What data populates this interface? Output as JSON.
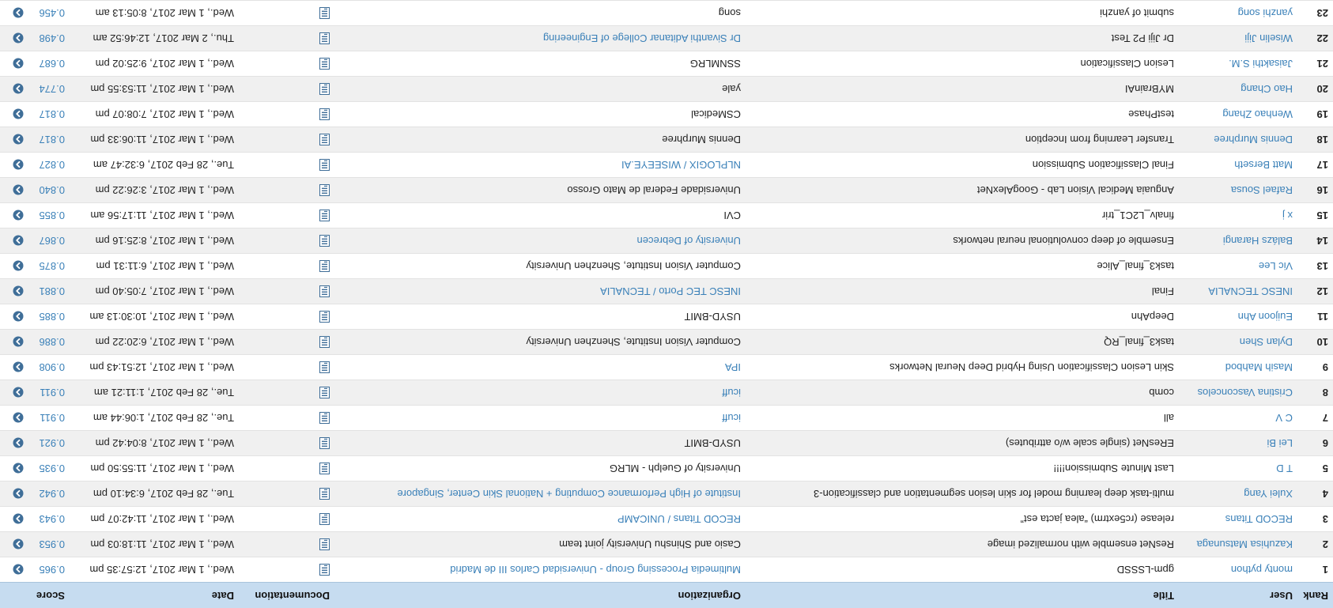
{
  "colors": {
    "header_bg": "#c6dcf0",
    "link": "#3a80b8",
    "row_alt": "#f0f0f0",
    "icon": "#3f6e98"
  },
  "columns": {
    "rank": "Rank",
    "user": "User",
    "title": "Title",
    "organization": "Organization",
    "documentation": "Documentation",
    "date": "Date",
    "score": "Score"
  },
  "rows": [
    {
      "rank": "1",
      "user": "monty python",
      "title": "gpm-LSSSD",
      "organization": "Multimedia Processing Group - Universidad Carlos III de Madrid",
      "org_link": true,
      "date": "Wed., 1 Mar 2017, 12:57:35 pm",
      "score": "0.965"
    },
    {
      "rank": "2",
      "user": "Kazuhisa Matsunaga",
      "title": "ResNet ensemble with normalized image",
      "organization": "Casio and Shinshu University joint team",
      "org_link": false,
      "date": "Wed., 1 Mar 2017, 11:18:03 pm",
      "score": "0.953"
    },
    {
      "rank": "3",
      "user": "RECOD Titans",
      "title": "release (rc5extrm) “alea jacta est”",
      "organization": "RECOD Titans / UNICAMP",
      "org_link": true,
      "date": "Wed., 1 Mar 2017, 11:42:07 pm",
      "score": "0.943"
    },
    {
      "rank": "4",
      "user": "Xulei Yang",
      "title": "multi-task deep learning model for skin lesion segmentation and classification-3",
      "organization": "Institute of High Performance Computing + National Skin Center, Singapore",
      "org_link": true,
      "date": "Tue., 28 Feb 2017, 6:34:10 pm",
      "score": "0.942"
    },
    {
      "rank": "5",
      "user": "T D",
      "title": "Last Minute Submission!!!!",
      "organization": "University of Guelph - MLRG",
      "org_link": false,
      "date": "Wed., 1 Mar 2017, 11:55:50 pm",
      "score": "0.935"
    },
    {
      "rank": "6",
      "user": "Lei Bi",
      "title": "EResNet (single scale w/o attributes)",
      "organization": "USYD-BMIT",
      "org_link": false,
      "date": "Wed., 1 Mar 2017, 8:04:42 pm",
      "score": "0.921"
    },
    {
      "rank": "7",
      "user": "C V",
      "title": "all",
      "organization": "icuff",
      "org_link": true,
      "date": "Tue., 28 Feb 2017, 1:06:44 am",
      "score": "0.911"
    },
    {
      "rank": "8",
      "user": "Cristina Vasconcelos",
      "title": "comb",
      "organization": "icuff",
      "org_link": true,
      "date": "Tue., 28 Feb 2017, 1:11:21 am",
      "score": "0.911"
    },
    {
      "rank": "9",
      "user": "Masih Mahbod",
      "title": "Skin Lesion Classification Using Hybrid Deep Neural Networks",
      "organization": "IPA",
      "org_link": true,
      "date": "Wed., 1 Mar 2017, 12:51:43 pm",
      "score": "0.908"
    },
    {
      "rank": "10",
      "user": "Dylan Shen",
      "title": "task3_final_RQ",
      "organization": "Computer Vision Institute, Shenzhen University",
      "org_link": false,
      "date": "Wed., 1 Mar 2017, 6:20:22 pm",
      "score": "0.886"
    },
    {
      "rank": "11",
      "user": "Euijoon Ahn",
      "title": "DeepAhn",
      "organization": "USYD-BMIT",
      "org_link": false,
      "date": "Wed., 1 Mar 2017, 10:30:13 am",
      "score": "0.885"
    },
    {
      "rank": "12",
      "user": "INESC TECNALIA",
      "title": "Final",
      "organization": "INESC TEC Porto / TECNALIA",
      "org_link": true,
      "date": "Wed., 1 Mar 2017, 7:05:40 pm",
      "score": "0.881"
    },
    {
      "rank": "13",
      "user": "Vic Lee",
      "title": "task3_final_Alice",
      "organization": "Computer Vision Institute, Shenzhen University",
      "org_link": false,
      "date": "Wed., 1 Mar 2017, 6:11:31 pm",
      "score": "0.875"
    },
    {
      "rank": "14",
      "user": "Balázs Harangi",
      "title": "Ensemble of deep convolutional neural networks",
      "organization": "University of Debrecen",
      "org_link": true,
      "date": "Wed., 1 Mar 2017, 8:25:16 pm",
      "score": "0.867"
    },
    {
      "rank": "15",
      "user": "x j",
      "title": "finalv_L2C1_trir",
      "organization": "CVI",
      "org_link": false,
      "date": "Wed., 1 Mar 2017, 11:17:56 am",
      "score": "0.855"
    },
    {
      "rank": "16",
      "user": "Rafael Sousa",
      "title": "Anguaia Medical Vision Lab - GoogAlexNet",
      "organization": "Universidade Federal de Mato Grosso",
      "org_link": false,
      "date": "Wed., 1 Mar 2017, 3:26:22 pm",
      "score": "0.840"
    },
    {
      "rank": "17",
      "user": "Matt Berseth",
      "title": "Final Classification Submission",
      "organization": "NLPLOGIX / WISEEYE.AI",
      "org_link": true,
      "date": "Tue., 28 Feb 2017, 6:32:47 am",
      "score": "0.827"
    },
    {
      "rank": "18",
      "user": "Dennis Murphree",
      "title": "Transfer Learning from Inception",
      "organization": "Dennis Murphree",
      "org_link": false,
      "date": "Wed., 1 Mar 2017, 11:06:33 pm",
      "score": "0.817"
    },
    {
      "rank": "19",
      "user": "Wenhao Zhang",
      "title": "testPhase",
      "organization": "CSMedical",
      "org_link": false,
      "date": "Wed., 1 Mar 2017, 7:08:07 pm",
      "score": "0.817"
    },
    {
      "rank": "20",
      "user": "Hao Chang",
      "title": "MYBrainAI",
      "organization": "yale",
      "org_link": false,
      "date": "Wed., 1 Mar 2017, 11:53:55 pm",
      "score": "0.774"
    },
    {
      "rank": "21",
      "user": "Jaisakthi S.M.",
      "title": "Lesion Classification",
      "organization": "SSNMLRG",
      "org_link": false,
      "date": "Wed., 1 Mar 2017, 9:25:02 pm",
      "score": "0.687"
    },
    {
      "rank": "22",
      "user": "Wiselin Jiji",
      "title": "Dr Jiji P2 Test",
      "organization": "Dr Sivanthi Aditanar College of Engineering",
      "org_link": true,
      "date": "Thu., 2 Mar 2017, 12:46:52 am",
      "score": "0.498"
    },
    {
      "rank": "23",
      "user": "yanzhi song",
      "title": "submit of yanzhi",
      "organization": "song",
      "org_link": false,
      "date": "Wed., 1 Mar 2017, 8:05:13 am",
      "score": "0.456"
    }
  ]
}
